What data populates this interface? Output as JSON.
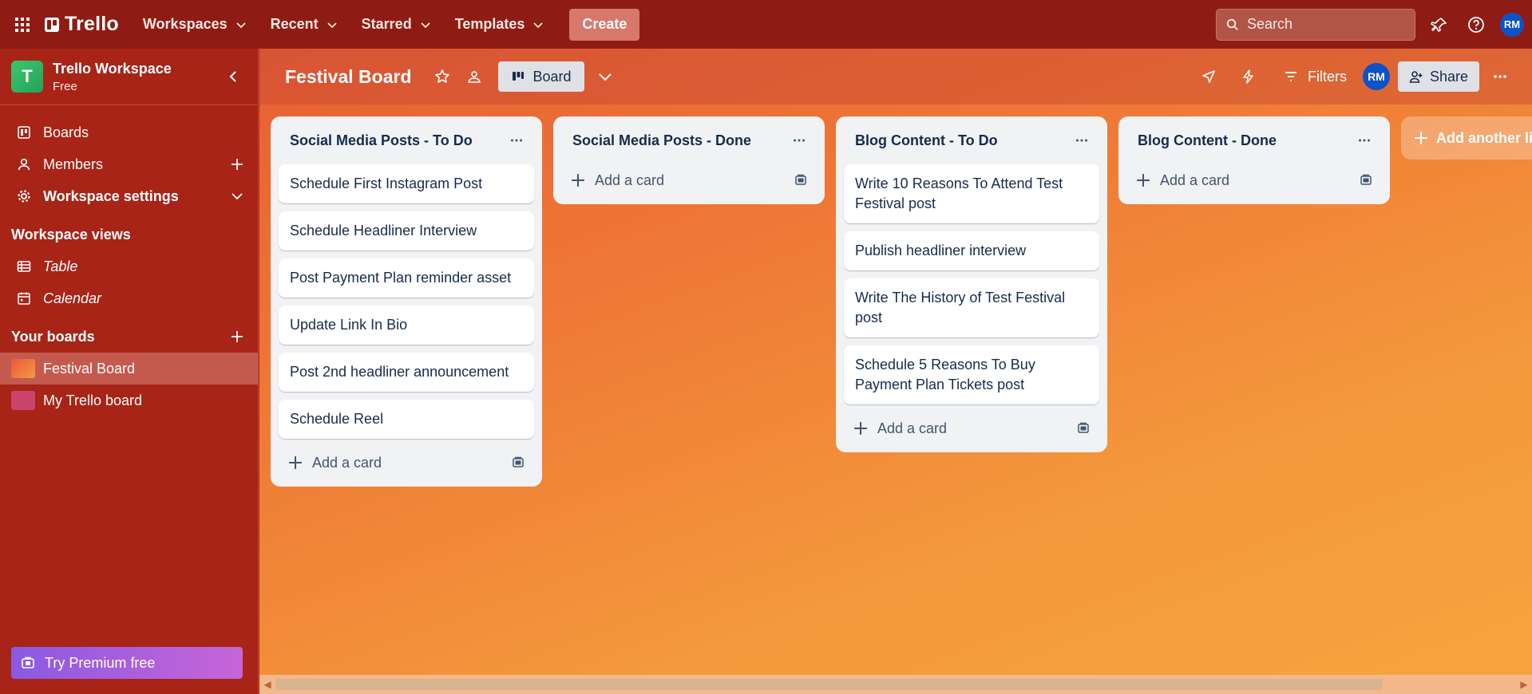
{
  "topnav": {
    "brand": "Trello",
    "menus": [
      {
        "label": "Workspaces"
      },
      {
        "label": "Recent"
      },
      {
        "label": "Starred"
      },
      {
        "label": "Templates"
      }
    ],
    "create_label": "Create",
    "search_placeholder": "Search",
    "avatar_initials": "RM"
  },
  "sidebar": {
    "workspace_initial": "T",
    "workspace_name": "Trello Workspace",
    "workspace_plan": "Free",
    "items": [
      {
        "label": "Boards"
      },
      {
        "label": "Members"
      },
      {
        "label": "Workspace settings"
      }
    ],
    "views_heading": "Workspace views",
    "views": [
      {
        "label": "Table"
      },
      {
        "label": "Calendar"
      }
    ],
    "boards_heading": "Your boards",
    "boards": [
      {
        "label": "Festival Board",
        "color": "#e8684a"
      },
      {
        "label": "My Trello board",
        "color": "#c9436c"
      }
    ],
    "premium_label": "Try Premium free"
  },
  "board": {
    "title": "Festival Board",
    "view_label": "Board",
    "filters_label": "Filters",
    "member_initials": "RM",
    "share_label": "Share",
    "lists": [
      {
        "title": "Social Media Posts - To Do",
        "cards": [
          "Schedule First Instagram Post",
          "Schedule Headliner Interview",
          "Post Payment Plan reminder asset",
          "Update Link In Bio",
          "Post 2nd headliner announcement",
          "Schedule Reel"
        ],
        "add_label": "Add a card"
      },
      {
        "title": "Social Media Posts - Done",
        "cards": [],
        "add_label": "Add a card"
      },
      {
        "title": "Blog Content - To Do",
        "cards": [
          "Write 10 Reasons To Attend Test Festival post",
          "Publish headliner interview",
          "Write The History of Test Festival post",
          "Schedule 5 Reasons To Buy Payment Plan Tickets post"
        ],
        "add_label": "Add a card"
      },
      {
        "title": "Blog Content - Done",
        "cards": [],
        "add_label": "Add a card"
      }
    ],
    "add_list_label": "Add another list"
  }
}
